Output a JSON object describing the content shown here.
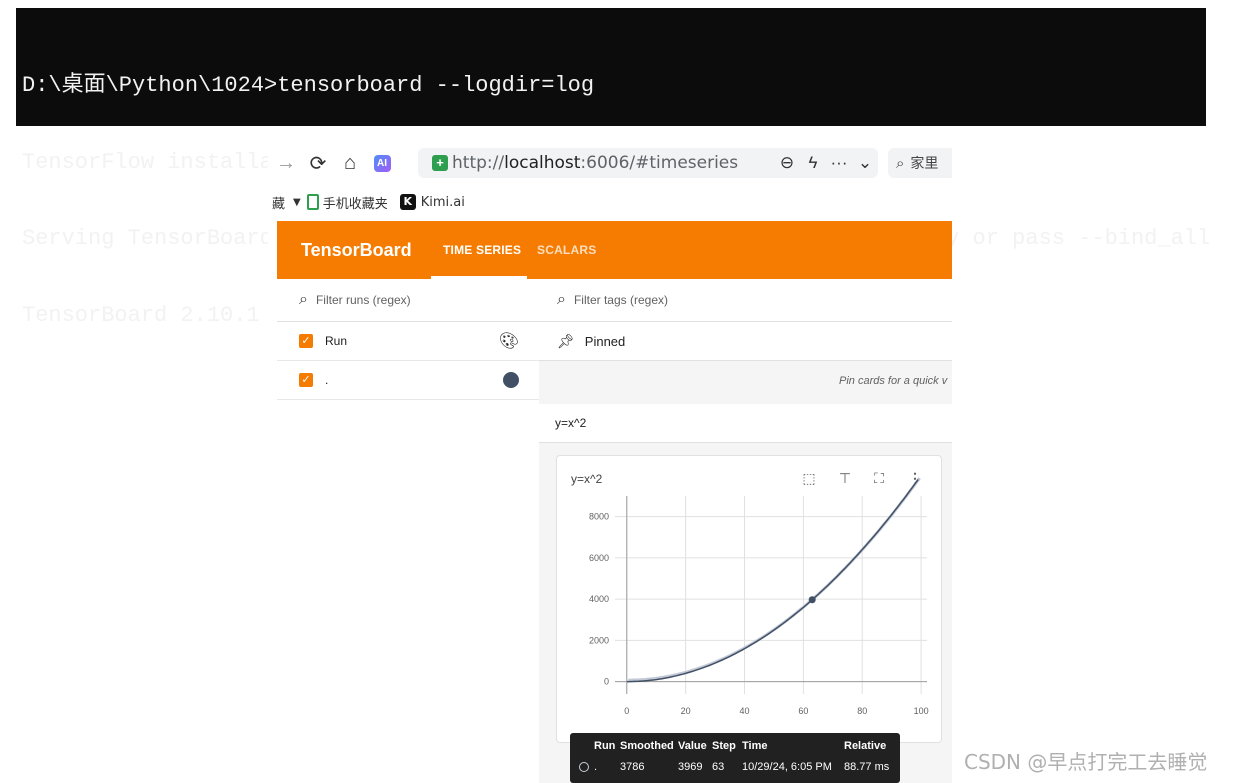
{
  "terminal": {
    "lines": [
      "D:\\桌面\\Python\\1024>tensorboard --logdir=log",
      "TensorFlow installation not found - running with reduced feature set.",
      "Serving TensorBoard on localhost; to expose to the network, use a proxy or pass --bind_all",
      "TensorBoard 2.10.1 at http://localhost:6006/ (Press CTRL+C to quit)"
    ]
  },
  "browser": {
    "url_prefix": "http://",
    "url_host": "localhost",
    "url_rest": ":6006/#timeseries",
    "search_placeholder": "家里",
    "ai_badge": "AI",
    "bookmarks": [
      {
        "label": "藏"
      },
      {
        "label": "手机收藏夹"
      },
      {
        "label": "Kimi.ai"
      }
    ]
  },
  "tensorboard": {
    "brand": "TensorBoard",
    "tabs": [
      "TIME SERIES",
      "SCALARS"
    ],
    "run_filter_placeholder": "Filter runs (regex)",
    "tag_filter_placeholder": "Filter tags (regex)",
    "runs": [
      {
        "label": "Run",
        "color": "#000000"
      },
      {
        "label": ".",
        "color": "#425066"
      }
    ],
    "pinned_label": "Pinned",
    "pin_hint": "Pin cards for a quick v",
    "group_title": "y=x^2",
    "card_title": "y=x^2"
  },
  "chart_data": {
    "type": "line",
    "title": "y=x^2",
    "xlim": [
      -4,
      102
    ],
    "ylim": [
      -600,
      9000
    ],
    "x_ticks": [
      0,
      20,
      40,
      60,
      80,
      100
    ],
    "y_ticks": [
      0,
      2000,
      4000,
      6000,
      8000
    ],
    "series": [
      {
        "formula": "y=x^2",
        "x_range": [
          0,
          99
        ],
        "color": "#425066"
      }
    ],
    "highlight": {
      "x": 63,
      "y": 3969
    }
  },
  "tooltip": {
    "headers": [
      "Run",
      "Smoothed",
      "Value",
      "Step",
      "Time",
      "Relative"
    ],
    "row": {
      "run": ".",
      "smoothed": "3786",
      "value": "3969",
      "step": "63",
      "time": "10/29/24, 6:05 PM",
      "relative": "88.77 ms"
    }
  },
  "watermark": "CSDN @早点打完工去睡觉"
}
